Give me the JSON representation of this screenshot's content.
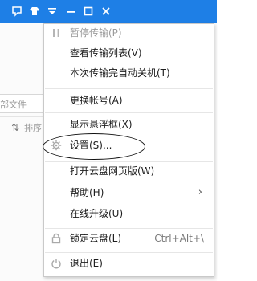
{
  "titlebar": {
    "color": "#1e7fe6",
    "icons": [
      "feedback-icon",
      "skin-icon",
      "menu-dropdown-icon",
      "minimize-icon",
      "maximize-icon",
      "close-icon"
    ]
  },
  "background": {
    "search_placeholder": "部文件",
    "sort_label": "排序"
  },
  "menu": {
    "items": [
      {
        "label": "暂停传输(P)",
        "icon": "pause-icon",
        "disabled": true
      },
      {
        "label": "查看传输列表(V)"
      },
      {
        "label": "本次传输完自动关机(T)"
      },
      {
        "label": "更换帐号(A)"
      },
      {
        "label": "显示悬浮框(X)"
      },
      {
        "label": "设置(S)...",
        "icon": "gear-icon",
        "highlighted": true
      },
      {
        "label": "打开云盘网页版(W)"
      },
      {
        "label": "帮助(H)",
        "submenu": true
      },
      {
        "label": "在线升级(U)"
      },
      {
        "label": "锁定云盘(L)",
        "icon": "lock-icon",
        "shortcut": "Ctrl+Alt+\\"
      },
      {
        "label": "退出(E)",
        "icon": "power-icon"
      }
    ],
    "submenu_arrow": "›"
  }
}
